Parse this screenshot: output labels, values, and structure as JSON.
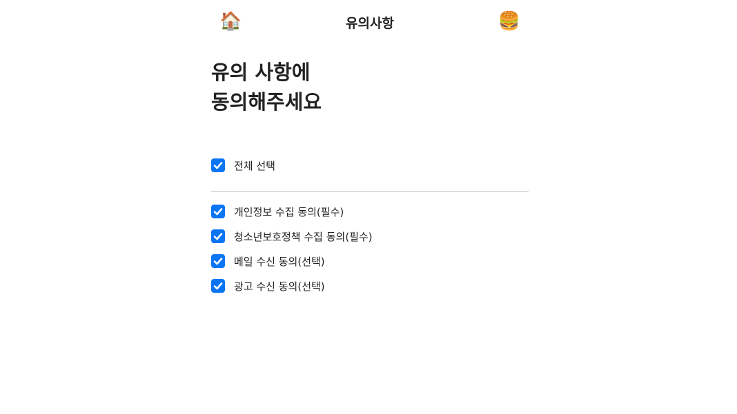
{
  "header": {
    "title": "유의사항",
    "home_icon": "🏠",
    "menu_icon": "🍔"
  },
  "main": {
    "title_line1": "유의 사항에",
    "title_line2": "동의해주세요",
    "select_all": {
      "label": "전체 선택",
      "checked": true
    },
    "items": [
      {
        "label": "개인정보 수집 동의(필수)",
        "checked": true
      },
      {
        "label": "청소년보호정책 수집 동의(필수)",
        "checked": true
      },
      {
        "label": "메일 수신 동의(선택)",
        "checked": true
      },
      {
        "label": "광고 수신 동의(선택)",
        "checked": true
      }
    ]
  },
  "colors": {
    "accent": "#0b75f5"
  }
}
